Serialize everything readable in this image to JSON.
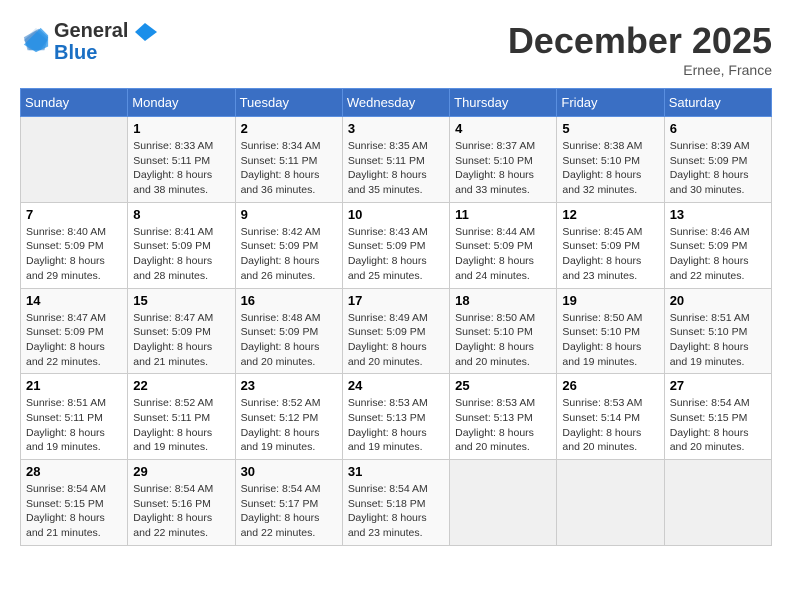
{
  "header": {
    "logo_general": "General",
    "logo_blue": "Blue",
    "month_title": "December 2025",
    "location": "Ernee, France"
  },
  "weekdays": [
    "Sunday",
    "Monday",
    "Tuesday",
    "Wednesday",
    "Thursday",
    "Friday",
    "Saturday"
  ],
  "weeks": [
    [
      {
        "day": "",
        "empty": true
      },
      {
        "day": "1",
        "sunrise": "8:33 AM",
        "sunset": "5:11 PM",
        "daylight": "8 hours and 38 minutes."
      },
      {
        "day": "2",
        "sunrise": "8:34 AM",
        "sunset": "5:11 PM",
        "daylight": "8 hours and 36 minutes."
      },
      {
        "day": "3",
        "sunrise": "8:35 AM",
        "sunset": "5:11 PM",
        "daylight": "8 hours and 35 minutes."
      },
      {
        "day": "4",
        "sunrise": "8:37 AM",
        "sunset": "5:10 PM",
        "daylight": "8 hours and 33 minutes."
      },
      {
        "day": "5",
        "sunrise": "8:38 AM",
        "sunset": "5:10 PM",
        "daylight": "8 hours and 32 minutes."
      },
      {
        "day": "6",
        "sunrise": "8:39 AM",
        "sunset": "5:09 PM",
        "daylight": "8 hours and 30 minutes."
      }
    ],
    [
      {
        "day": "7",
        "sunrise": "8:40 AM",
        "sunset": "5:09 PM",
        "daylight": "8 hours and 29 minutes."
      },
      {
        "day": "8",
        "sunrise": "8:41 AM",
        "sunset": "5:09 PM",
        "daylight": "8 hours and 28 minutes."
      },
      {
        "day": "9",
        "sunrise": "8:42 AM",
        "sunset": "5:09 PM",
        "daylight": "8 hours and 26 minutes."
      },
      {
        "day": "10",
        "sunrise": "8:43 AM",
        "sunset": "5:09 PM",
        "daylight": "8 hours and 25 minutes."
      },
      {
        "day": "11",
        "sunrise": "8:44 AM",
        "sunset": "5:09 PM",
        "daylight": "8 hours and 24 minutes."
      },
      {
        "day": "12",
        "sunrise": "8:45 AM",
        "sunset": "5:09 PM",
        "daylight": "8 hours and 23 minutes."
      },
      {
        "day": "13",
        "sunrise": "8:46 AM",
        "sunset": "5:09 PM",
        "daylight": "8 hours and 22 minutes."
      }
    ],
    [
      {
        "day": "14",
        "sunrise": "8:47 AM",
        "sunset": "5:09 PM",
        "daylight": "8 hours and 22 minutes."
      },
      {
        "day": "15",
        "sunrise": "8:47 AM",
        "sunset": "5:09 PM",
        "daylight": "8 hours and 21 minutes."
      },
      {
        "day": "16",
        "sunrise": "8:48 AM",
        "sunset": "5:09 PM",
        "daylight": "8 hours and 20 minutes."
      },
      {
        "day": "17",
        "sunrise": "8:49 AM",
        "sunset": "5:09 PM",
        "daylight": "8 hours and 20 minutes."
      },
      {
        "day": "18",
        "sunrise": "8:50 AM",
        "sunset": "5:10 PM",
        "daylight": "8 hours and 20 minutes."
      },
      {
        "day": "19",
        "sunrise": "8:50 AM",
        "sunset": "5:10 PM",
        "daylight": "8 hours and 19 minutes."
      },
      {
        "day": "20",
        "sunrise": "8:51 AM",
        "sunset": "5:10 PM",
        "daylight": "8 hours and 19 minutes."
      }
    ],
    [
      {
        "day": "21",
        "sunrise": "8:51 AM",
        "sunset": "5:11 PM",
        "daylight": "8 hours and 19 minutes."
      },
      {
        "day": "22",
        "sunrise": "8:52 AM",
        "sunset": "5:11 PM",
        "daylight": "8 hours and 19 minutes."
      },
      {
        "day": "23",
        "sunrise": "8:52 AM",
        "sunset": "5:12 PM",
        "daylight": "8 hours and 19 minutes."
      },
      {
        "day": "24",
        "sunrise": "8:53 AM",
        "sunset": "5:13 PM",
        "daylight": "8 hours and 19 minutes."
      },
      {
        "day": "25",
        "sunrise": "8:53 AM",
        "sunset": "5:13 PM",
        "daylight": "8 hours and 20 minutes."
      },
      {
        "day": "26",
        "sunrise": "8:53 AM",
        "sunset": "5:14 PM",
        "daylight": "8 hours and 20 minutes."
      },
      {
        "day": "27",
        "sunrise": "8:54 AM",
        "sunset": "5:15 PM",
        "daylight": "8 hours and 20 minutes."
      }
    ],
    [
      {
        "day": "28",
        "sunrise": "8:54 AM",
        "sunset": "5:15 PM",
        "daylight": "8 hours and 21 minutes."
      },
      {
        "day": "29",
        "sunrise": "8:54 AM",
        "sunset": "5:16 PM",
        "daylight": "8 hours and 22 minutes."
      },
      {
        "day": "30",
        "sunrise": "8:54 AM",
        "sunset": "5:17 PM",
        "daylight": "8 hours and 22 minutes."
      },
      {
        "day": "31",
        "sunrise": "8:54 AM",
        "sunset": "5:18 PM",
        "daylight": "8 hours and 23 minutes."
      },
      {
        "day": "",
        "empty": true
      },
      {
        "day": "",
        "empty": true
      },
      {
        "day": "",
        "empty": true
      }
    ]
  ],
  "labels": {
    "sunrise": "Sunrise:",
    "sunset": "Sunset:",
    "daylight": "Daylight:"
  }
}
